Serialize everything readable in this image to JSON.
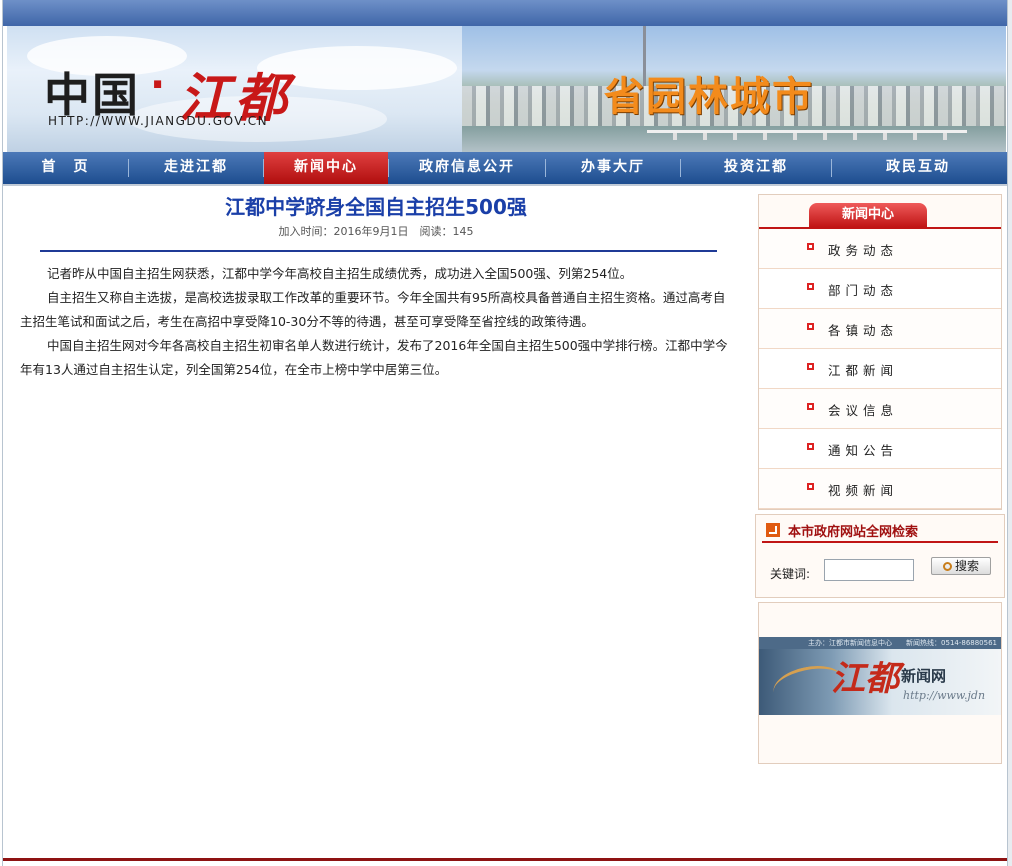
{
  "header": {
    "logo_cn": "中国",
    "logo_dot": "·",
    "logo_red": "江都",
    "logo_url": "HTTP://WWW.JIANGDU.GOV.CN",
    "slogan": "省园林城市"
  },
  "nav": {
    "items": [
      {
        "label": "首　页"
      },
      {
        "label": "走进江都"
      },
      {
        "label": "新闻中心",
        "active": true
      },
      {
        "label": "政府信息公开"
      },
      {
        "label": "办事大厅"
      },
      {
        "label": "投资江都"
      },
      {
        "label": "政民互动"
      }
    ]
  },
  "article": {
    "title": "江都中学跻身全国自主招生500强",
    "meta": "加入时间：2016年9月1日　阅读：145",
    "paragraphs": [
      "记者昨从中国自主招生网获悉，江都中学今年高校自主招生成绩优秀，成功进入全国500强、列第254位。",
      "自主招生又称自主选拔，是高校选拔录取工作改革的重要环节。今年全国共有95所高校具备普通自主招生资格。通过高考自主招生笔试和面试之后，考生在高招中享受降10-30分不等的待遇，甚至可享受降至省控线的政策待遇。",
      "中国自主招生网对今年各高校自主招生初审名单人数进行统计，发布了2016年全国自主招生500强中学排行榜。江都中学今年有13人通过自主招生认定，列全国第254位，在全市上榜中学中居第三位。"
    ]
  },
  "sidebar": {
    "tab": "新闻中心",
    "items": [
      {
        "label": "政务动态"
      },
      {
        "label": "部门动态"
      },
      {
        "label": "各镇动态"
      },
      {
        "label": "江都新闻"
      },
      {
        "label": "会议信息"
      },
      {
        "label": "通知公告"
      },
      {
        "label": "视频新闻"
      }
    ]
  },
  "search": {
    "title": "本市政府网站全网检索",
    "label": "关键词:",
    "value": "",
    "button": "搜索"
  },
  "news_banner": {
    "top_text": "主办：江都市新闻信息中心　　新闻热线：0514-86880561",
    "logo": "江都",
    "name": "新闻网",
    "url": "http://www.jdn"
  },
  "colors": {
    "nav_bg": "#1d4d8f",
    "nav_active": "#c01515",
    "title": "#1a3fa8",
    "slogan": "#f38b1c",
    "footer": "#8e1212"
  }
}
